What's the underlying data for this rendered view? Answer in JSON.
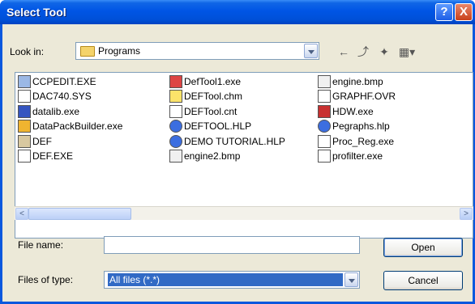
{
  "window": {
    "title": "Select Tool",
    "help": "?",
    "close": "X"
  },
  "toolbar": {
    "lookin_label": "Look in:",
    "lookin_value": "Programs",
    "back": "←",
    "up": "⤴",
    "newfolder": "✦",
    "views": "▦▾"
  },
  "files": [
    [
      "CCPEDIT.EXE",
      "DAC740.SYS",
      "datalib.exe",
      "DataPackBuilder.exe",
      "DEF",
      "DEF.EXE"
    ],
    [
      "DefTool1.exe",
      "DEFTool.chm",
      "DEFTool.cnt",
      "DEFTOOL.HLP",
      "DEMO TUTORIAL.HLP",
      "engine2.bmp"
    ],
    [
      "engine.bmp",
      "GRAPHF.OVR",
      "HDW.exe",
      "Pegraphs.hlp",
      "Proc_Reg.exe",
      "profilter.exe"
    ]
  ],
  "form": {
    "filename_label": "File name:",
    "filename_value": "",
    "filetype_label": "Files of type:",
    "filetype_value": "All files (*.*)"
  },
  "buttons": {
    "open": "Open",
    "cancel": "Cancel"
  },
  "scroll": {
    "left": "<",
    "right": ">"
  }
}
